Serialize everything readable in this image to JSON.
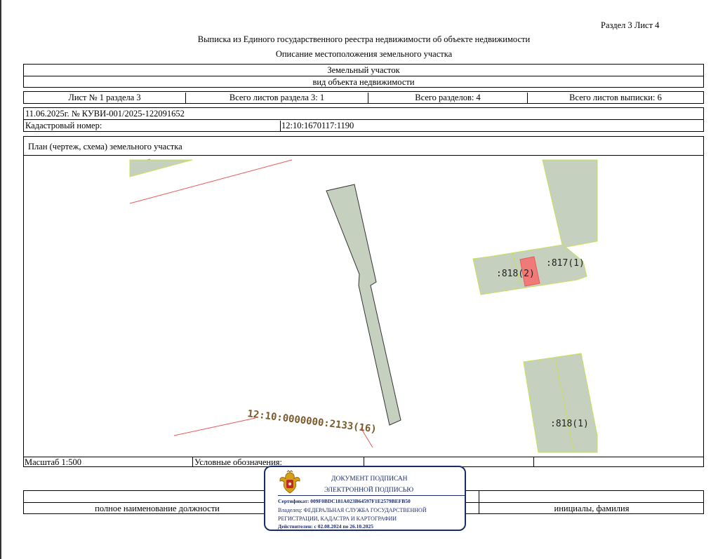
{
  "header": {
    "section_sheet": "Раздел 3    Лист 4",
    "title": "Выписка из Единого государственного реестра недвижимости об объекте недвижимости",
    "subtitle": "Описание местоположения земельного участка"
  },
  "object": {
    "type": "Земельный участок",
    "type_caption": "вид объекта недвижимости"
  },
  "sheets": {
    "sheet_of_section": "Лист № 1 раздела 3",
    "total_section_sheets": "Всего листов раздела 3: 1",
    "total_sections": "Всего разделов: 4",
    "total_extract_sheets": "Всего листов выписки: 6"
  },
  "record": {
    "date_number": "11.06.2025г. № КУВИ-001/2025-122091652",
    "cadastral_label": "Кадастровый номер:",
    "cadastral_value": "12:10:1670117:1190"
  },
  "plan": {
    "title": "План (чертеж, схема) земельного участка",
    "labels": {
      "main_parcel": "12:10:0000000:2133(16)",
      "p818_2": ":818(2)",
      "p817_1": ":817(1)",
      "p818_1": ":818(1)"
    },
    "colors": {
      "parcel_fill": "#c5d0bf",
      "parcel_edge": "#c8e05a",
      "boundary": "#e8585a",
      "highlight": "#f07a78",
      "label_brown": "#7a5a2a"
    }
  },
  "footer": {
    "scale": "Масштаб 1:500",
    "legend": "Условные обозначения:",
    "position_caption": "полное наименование должности",
    "name_caption": "инициалы, фамилия"
  },
  "stamp": {
    "line1": "ДОКУМЕНТ ПОДПИСАН",
    "line2": "ЭЛЕКТРОННОЙ ПОДПИСЬЮ",
    "certificate": "Сертификат: 009F0BDC181A023B64597F1E2579BEFB50",
    "owner_1": "Владелец: ФЕДЕРАЛЬНАЯ СЛУЖБА ГОСУДАРСТВЕННОЙ",
    "owner_2": "РЕГИСТРАЦИИ, КАДАСТРА И КАРТОГРАФИИ",
    "validity": "Действителен: с 02.08.2024 по 26.10.2025",
    "color": "#1a2a6c",
    "emblem": "eagle-emblem-icon"
  }
}
